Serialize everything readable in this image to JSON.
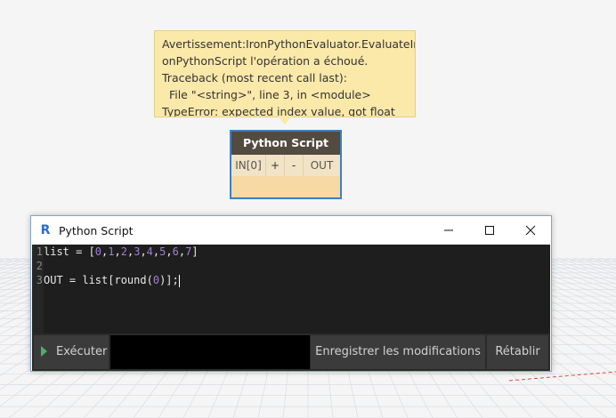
{
  "warning": {
    "lines": [
      "Avertissement:IronPythonEvaluator.EvaluateIr",
      "onPythonScript l'opération a échoué.",
      "Traceback (most recent call last):",
      "  File \"<string>\", line 3, in <module>",
      "TypeError: expected index value, got float"
    ]
  },
  "node": {
    "title": "Python Script",
    "in_port": "IN[0]",
    "add_label": "+",
    "remove_label": "-",
    "out_port": "OUT"
  },
  "editor_window": {
    "title": "Python Script",
    "app_icon": "revit-r-icon",
    "code": {
      "line_numbers": [
        "1",
        "2",
        "3"
      ],
      "line1": {
        "prefix": "list = [",
        "n0": "0",
        "n1": "1",
        "n2": "2",
        "n3": "3",
        "n4": "4",
        "n5": "5",
        "n6": "6",
        "n7": "7",
        "suffix": "]"
      },
      "line2": "",
      "line3": {
        "prefix": "OUT = list[round(",
        "arg": "0",
        "suffix": ")];"
      }
    },
    "buttons": {
      "run": "Exécuter",
      "save": "Enregistrer les modifications",
      "revert": "Rétablir"
    }
  },
  "colors": {
    "warning_bg": "#fbe9a9",
    "node_title_bg": "#534a40",
    "node_selected_border": "#3d7fc4",
    "editor_bg": "#1e1e1e",
    "number_color": "#a07fd0",
    "run_icon": "#4caf6c"
  }
}
